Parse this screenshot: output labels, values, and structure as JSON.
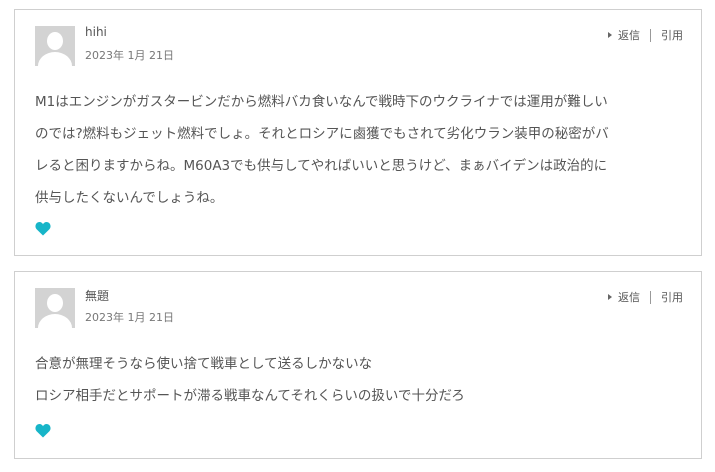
{
  "colors": {
    "heart": "#17b5c8",
    "border": "#cfcfcf",
    "avatar_bg": "#d3d3d3"
  },
  "comments": [
    {
      "author": "hihi",
      "date": "2023年 1月 21日",
      "reply_label": "返信",
      "quote_label": "引用",
      "lines": [
        "M1はエンジンがガスタービンだから燃料バカ食いなんで戦時下のウクライナでは運用が難しい",
        "のでは?燃料もジェット燃料でしょ。それとロシアに鹵獲でもされて劣化ウラン装甲の秘密がバ",
        "レると困りますからね。M60A3でも供与してやればいいと思うけど、まぁバイデンは政治的に",
        "供与したくないんでしょうね。"
      ]
    },
    {
      "author": "無題",
      "date": "2023年 1月 21日",
      "reply_label": "返信",
      "quote_label": "引用",
      "lines": [
        "合意が無理そうなら使い捨て戦車として送るしかないな",
        "ロシア相手だとサポートが滞る戦車なんてそれくらいの扱いで十分だろ"
      ]
    }
  ]
}
